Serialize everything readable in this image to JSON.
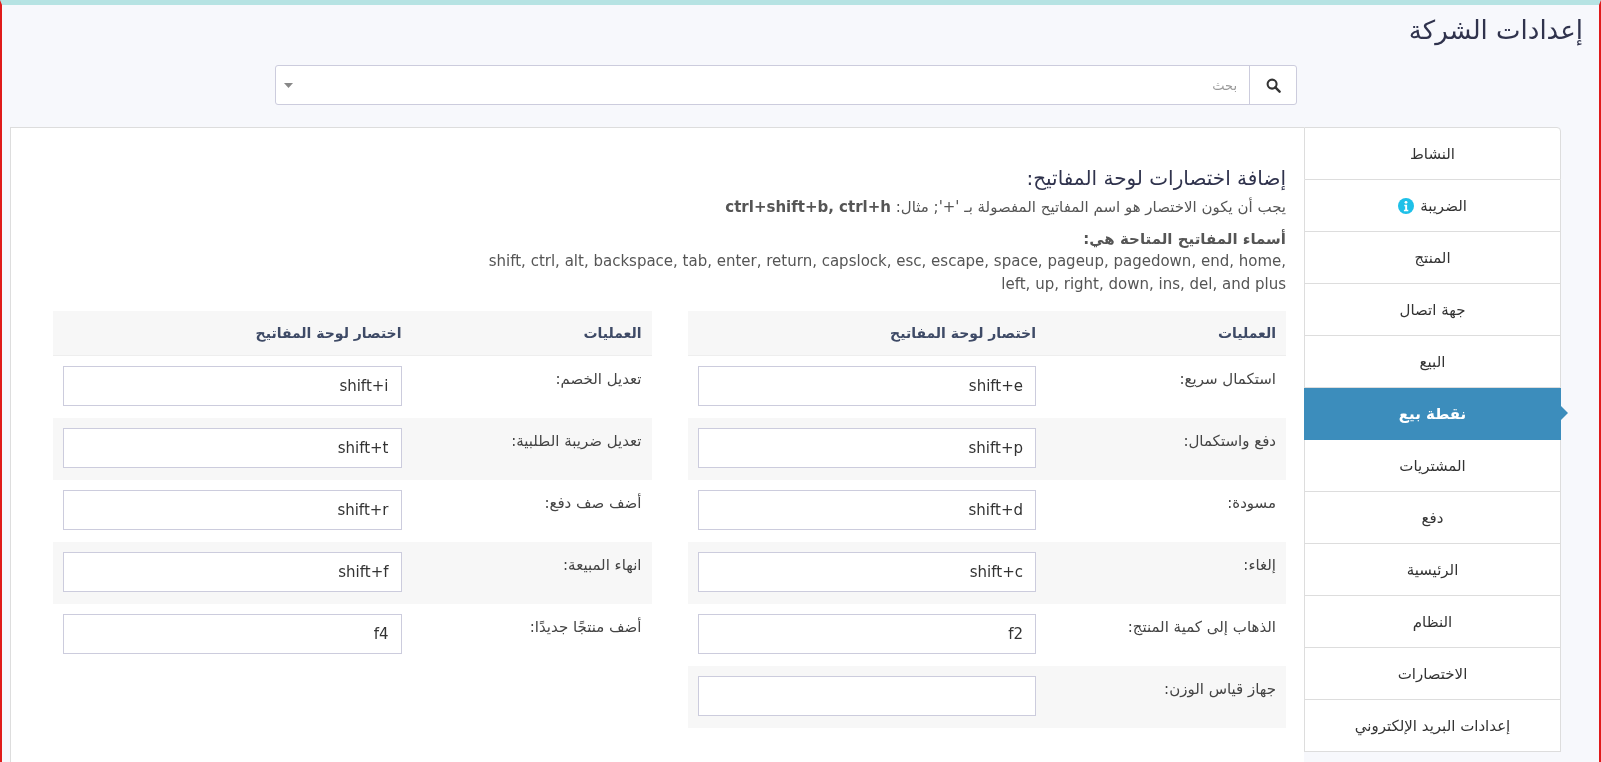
{
  "page_title": "إعدادات الشركة",
  "search": {
    "placeholder": "بحث"
  },
  "sidebar": {
    "items": [
      {
        "label": "النشاط",
        "selected": false,
        "info": false
      },
      {
        "label": "الضريبة",
        "selected": false,
        "info": true
      },
      {
        "label": "المنتج",
        "selected": false,
        "info": false
      },
      {
        "label": "جهة اتصال",
        "selected": false,
        "info": false
      },
      {
        "label": "البيع",
        "selected": false,
        "info": false
      },
      {
        "label": "نقطة بيع",
        "selected": true,
        "info": false
      },
      {
        "label": "المشتريات",
        "selected": false,
        "info": false
      },
      {
        "label": "دفع",
        "selected": false,
        "info": false
      },
      {
        "label": "الرئيسية",
        "selected": false,
        "info": false
      },
      {
        "label": "النظام",
        "selected": false,
        "info": false
      },
      {
        "label": "الاختصارات",
        "selected": false,
        "info": false
      },
      {
        "label": "إعدادات البريد الإلكتروني",
        "selected": false,
        "info": false
      }
    ]
  },
  "section": {
    "heading": "إضافة اختصارات لوحة المفاتيح:",
    "instruction": "يجب أن يكون الاختصار هو اسم المفاتيح المفصولة بـ '+'; مثال: **ctrl+shift+b, ctrl+h**",
    "keys_heading": "أسماء المفاتيح المتاحة هي:",
    "keys_list": "shift, ctrl, alt, backspace, tab, enter, return, capslock, esc, escape, space, pageup, pagedown, end, home, left, up, right, down, ins, del, and plus"
  },
  "tables": [
    {
      "columns": [
        "العمليات",
        "اختصار لوحة المفاتيح"
      ],
      "rows": [
        {
          "label": "استكمال سريع:",
          "value": "shift+e"
        },
        {
          "label": "دفع واستكمال:",
          "value": "shift+p"
        },
        {
          "label": "مسودة:",
          "value": "shift+d"
        },
        {
          "label": "إلغاء:",
          "value": "shift+c"
        },
        {
          "label": "الذهاب إلى كمية المنتج:",
          "value": "f2"
        },
        {
          "label": "جهاز قياس الوزن:"
        }
      ]
    },
    {
      "columns": [
        "العمليات",
        "اختصار لوحة المفاتيح"
      ],
      "rows": [
        {
          "label": "تعديل الخصم:",
          "value": "shift+i"
        },
        {
          "label": "تعديل ضريبة الطلبية:",
          "value": "shift+t"
        },
        {
          "label": "أضف صف دفع:",
          "value": "shift+r"
        },
        {
          "label": "انهاء المبيعة:",
          "value": "shift+f"
        },
        {
          "label": "أضف منتجًا جديدًا:",
          "value": "f4"
        }
      ]
    }
  ]
}
